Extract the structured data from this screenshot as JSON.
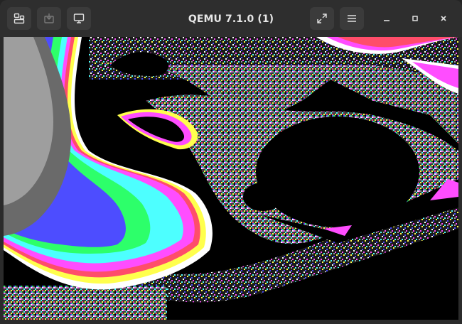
{
  "window": {
    "title": "QEMU 7.1.0 (1)"
  },
  "toolbar": {
    "left_icons": [
      "tabs-icon",
      "screenshot-icon",
      "display-icon"
    ],
    "right_icons": [
      "fullscreen-icon",
      "hamburger-menu-icon"
    ]
  },
  "window_controls": [
    "minimize-icon",
    "maximize-icon",
    "close-icon"
  ],
  "colors": {
    "headerbar": "#2e2e2e",
    "button": "#3b3b3b",
    "title": "#e6e6e6",
    "fractal_palette": [
      "#9e9e9e",
      "#6a6a6a",
      "#4d4dff",
      "#2dff6a",
      "#4dffff",
      "#ff4dff",
      "#ff4d6a",
      "#ffff4d",
      "#ffffff",
      "#000000"
    ]
  }
}
